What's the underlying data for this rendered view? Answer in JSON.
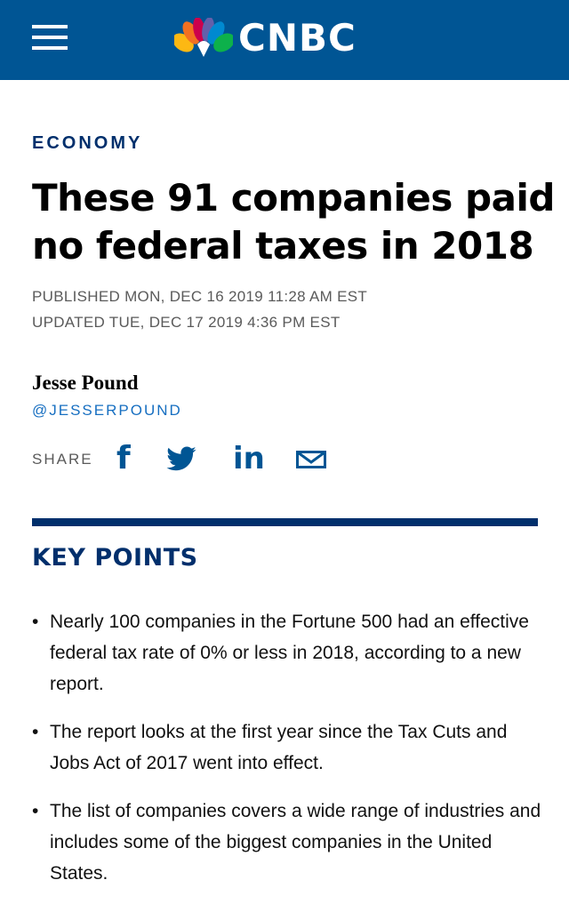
{
  "header": {
    "brand": "CNBC",
    "menu_icon": "hamburger-menu-icon",
    "logo_icon": "peacock-logo-icon",
    "background": "#005594",
    "peacock_colors": [
      "#fdb813",
      "#f37021",
      "#cc004c",
      "#6460aa",
      "#0089d0",
      "#0db14b"
    ]
  },
  "article": {
    "section": "ECONOMY",
    "headline": "These 91 companies paid no federal taxes in 2018",
    "published": "PUBLISHED MON, DEC 16 2019 11:28 AM EST",
    "updated": "UPDATED TUE, DEC 17 2019 4:36 PM EST",
    "author": "Jesse Pound",
    "handle": "@JESSERPOUND"
  },
  "share": {
    "label": "SHARE",
    "facebook": "f",
    "linkedin": "in",
    "icons": [
      "facebook-icon",
      "twitter-icon",
      "linkedin-icon",
      "email-icon"
    ]
  },
  "key_points": {
    "title": "KEY POINTS",
    "bullet": "•",
    "items": [
      "Nearly 100 companies in the Fortune 500 had an effective federal tax rate of 0% or less in 2018, according to a new report.",
      "The report looks at the first year since the Tax Cuts and Jobs Act of 2017 went into effect.",
      "The list of companies covers a wide range of industries and includes some of the biggest companies in the United States."
    ]
  },
  "colors": {
    "accent_dark": "#002f6c",
    "link": "#176fc1",
    "meta": "#5a5a5a"
  }
}
